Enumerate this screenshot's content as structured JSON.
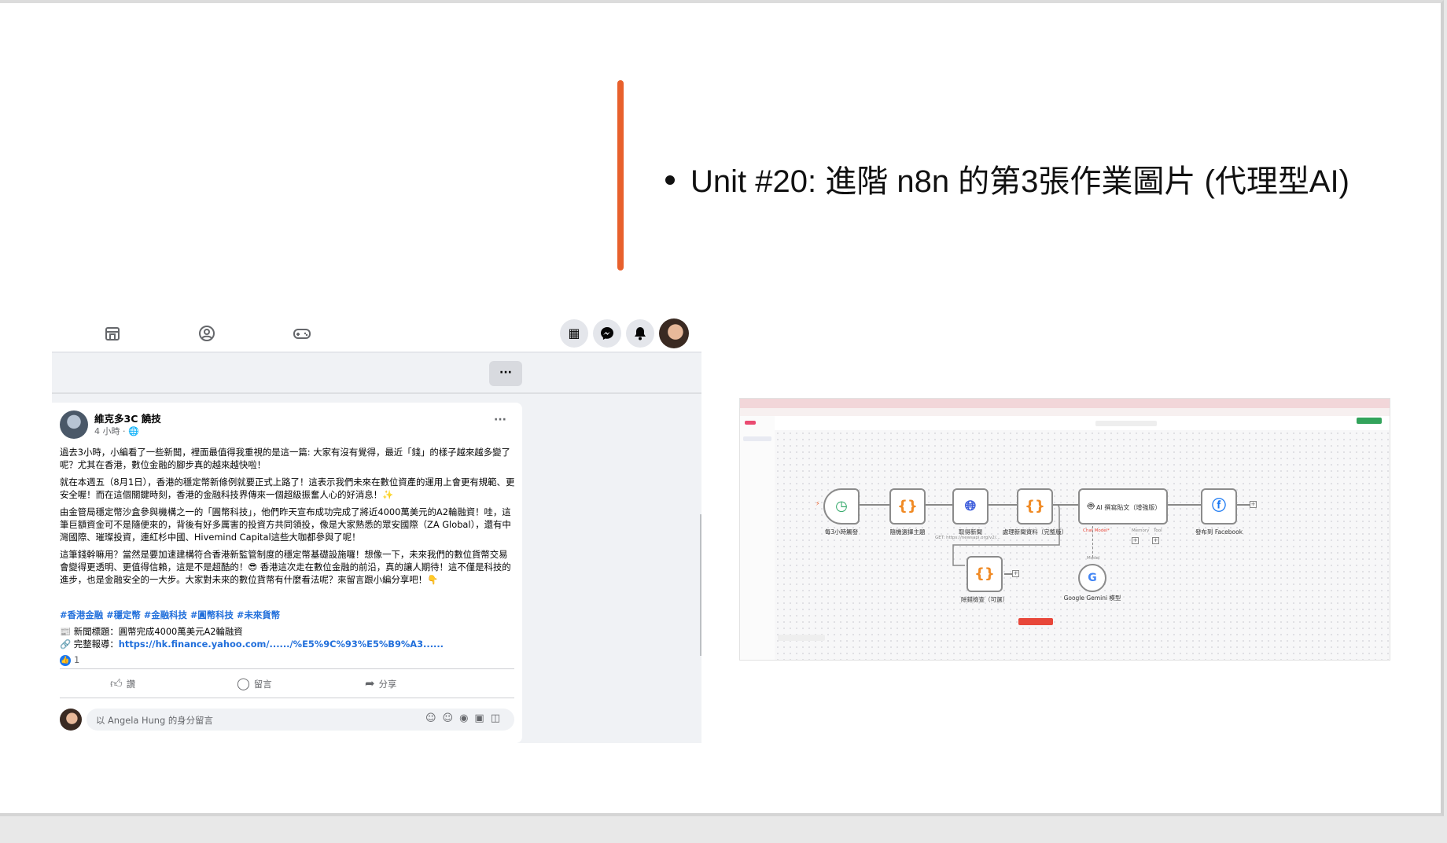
{
  "slide": {
    "bullet": "Unit #20: 進階 n8n 的第3張作業圖片 (代理型AI)",
    "accent_color": "#e8602c"
  },
  "facebook": {
    "nav_icons": [
      "marketplace-icon",
      "groups-icon",
      "gaming-icon"
    ],
    "top_right_icons": [
      "apps-grid-icon",
      "messenger-icon",
      "notifications-icon",
      "profile-avatar"
    ],
    "more_button": "···",
    "post": {
      "author": "維克多3C 饒技",
      "time": "4 小時 · ",
      "paragraphs": [
        "過去3小時，小編看了一些新聞，裡面最值得我重視的是這一篇: 大家有沒有覺得，最近「錢」的樣子越來越多變了呢？尤其在香港，數位金融的腳步真的越來越快啦！",
        "就在本週五（8月1日），香港的穩定幣新條例就要正式上路了！這表示我們未來在數位資產的運用上會更有規範、更安全喔！而在這個關鍵時刻，香港的金融科技界傳來一個超級振奮人心的好消息！✨",
        "由金管局穩定幣沙盒參與機構之一的「圓幣科技」，他們昨天宣布成功完成了將近4000萬美元的A2輪融資！哇，這筆巨額資金可不是隨便來的，背後有好多厲害的投資方共同領投，像是大家熟悉的眾安國際（ZA Global），還有中灣國際、璀璨投資，連紅杉中國、Hivemind Capital這些大咖都參與了呢！",
        "這筆錢幹嘛用？當然是要加速建構符合香港新監管制度的穩定幣基礎設施囉！想像一下，未來我們的數位貨幣交易會變得更透明、更值得信賴，這是不是超酷的！😎 香港這次走在數位金融的前沿，真的讓人期待！這不僅是科技的進步，也是金融安全的一大步。大家對未來的數位貨幣有什麼看法呢？來留言跟小編分享吧！👇"
      ],
      "hashtags": "#香港金融 #穩定幣 #金融科技 #圓幣科技 #未來貨幣",
      "news_title": "📰 新聞標題：圓幣完成4000萬美元A2輪融資",
      "report_label": "🔗 完整報導：",
      "report_link": "https://hk.finance.yahoo.com/....../%E5%9C%93%E5%B9%A3......",
      "like_count": "1",
      "actions": {
        "like": "讚",
        "comment": "留言",
        "share": "分享"
      },
      "comment_placeholder": "以 Angela Hung 的身分留言"
    }
  },
  "n8n": {
    "nodes": [
      {
        "label": "每3小時觸發",
        "icon": "clock-icon"
      },
      {
        "label": "隨機選擇主題",
        "icon": "code-braces-icon"
      },
      {
        "label": "取得新聞",
        "sub": "GET: https://newsapi.org/v2/...",
        "icon": "globe-icon"
      },
      {
        "label": "處理新聞資料（完整版）",
        "icon": "code-braces-icon"
      },
      {
        "label": "AI 撰寫貼文（增強版）",
        "icon": "robot-icon"
      },
      {
        "label": "發布到 Facebook",
        "icon": "facebook-icon"
      },
      {
        "label": "除錯檢查（可選）",
        "icon": "code-braces-icon"
      },
      {
        "label": "Google Gemini 模型",
        "icon": "google-icon"
      }
    ],
    "agent_ports": [
      "Chat Model*",
      "Memory",
      "Tool"
    ],
    "model_port": "Model"
  }
}
